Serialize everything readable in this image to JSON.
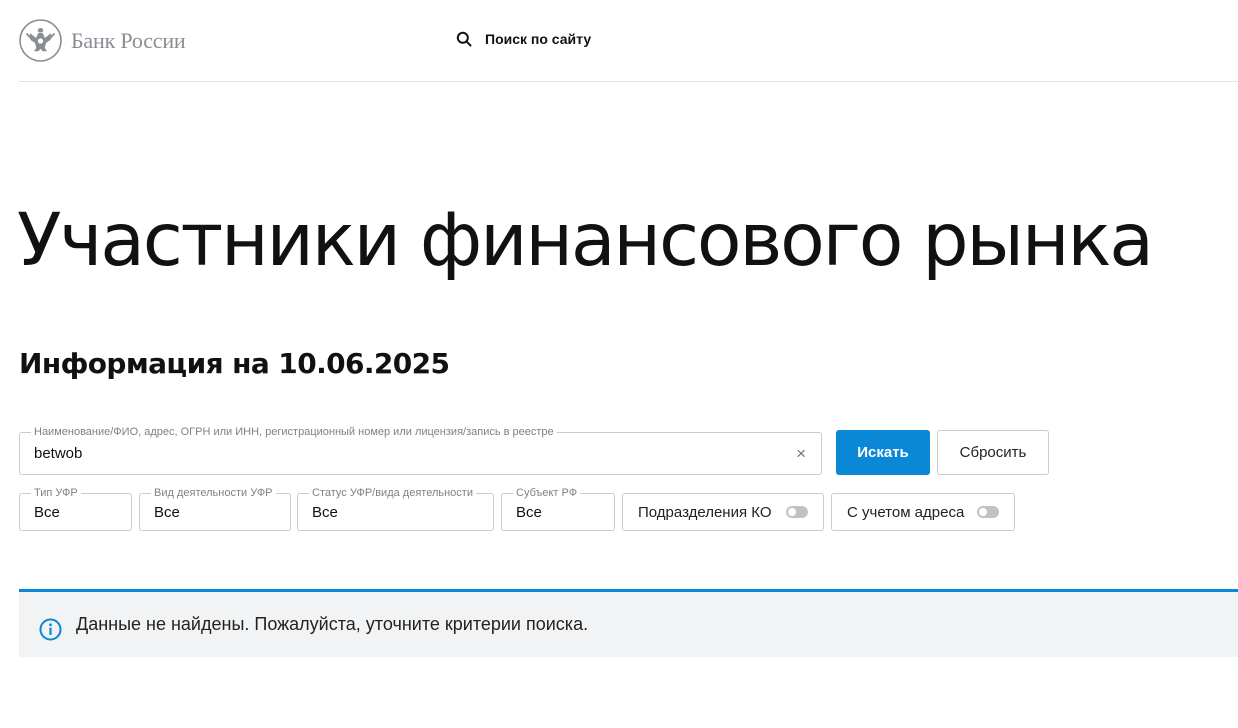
{
  "header": {
    "logo_text": "Банк России",
    "search_label": "Поиск по сайту"
  },
  "page": {
    "title": "Участники финансового рынка",
    "info_date": "Информация на 10.06.2025"
  },
  "search": {
    "label": "Наименование/ФИО, адрес, ОГРН или ИНН, регистрационный номер или лицензия/запись в реестре",
    "value": "betwob",
    "clear_symbol": "×",
    "submit_label": "Искать",
    "reset_label": "Сбросить"
  },
  "filters": {
    "type": {
      "label": "Тип УФР",
      "value": "Все"
    },
    "activity": {
      "label": "Вид деятельности УФР",
      "value": "Все"
    },
    "status": {
      "label": "Статус УФР/вида деятельности",
      "value": "Все"
    },
    "region": {
      "label": "Субъект РФ",
      "value": "Все"
    },
    "branches_toggle": {
      "label": "Подразделения КО",
      "on": false
    },
    "address_toggle": {
      "label": "С учетом адреса",
      "on": false
    }
  },
  "notice": {
    "icon": "info-icon",
    "text": "Данные не найдены. Пожалуйста, уточните критерии поиска."
  },
  "colors": {
    "accent": "#0a88d6",
    "logo_gray": "#8a8d93",
    "notice_bg": "#f2f3f4"
  }
}
